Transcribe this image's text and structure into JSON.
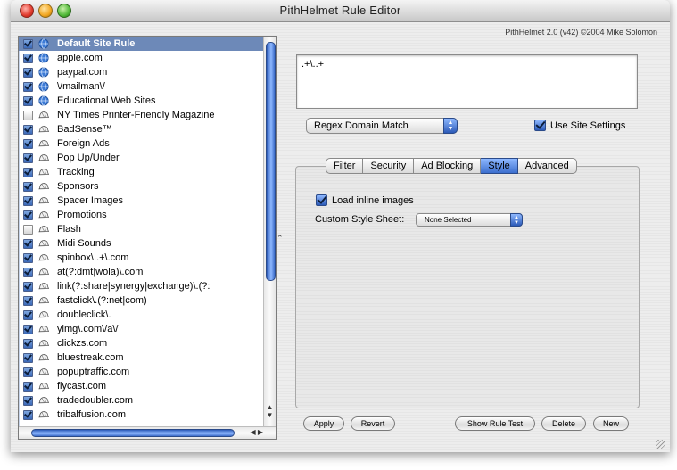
{
  "window": {
    "title": "PithHelmet Rule Editor",
    "copyright": "PithHelmet 2.0 (v42) ©2004 Mike Solomon"
  },
  "rules": [
    {
      "label": "Default Site Rule",
      "checked": true,
      "icon": "globe-icon",
      "selected": true
    },
    {
      "label": "apple.com",
      "checked": true,
      "icon": "globe-icon"
    },
    {
      "label": "paypal.com",
      "checked": true,
      "icon": "globe-icon"
    },
    {
      "label": "\\/mailman\\/",
      "checked": true,
      "icon": "globe-icon"
    },
    {
      "label": "Educational Web Sites",
      "checked": true,
      "icon": "globe-icon"
    },
    {
      "label": "NY Times Printer-Friendly Magazine",
      "checked": false,
      "icon": "pith-helmet-icon"
    },
    {
      "label": "BadSense™",
      "checked": true,
      "icon": "pith-helmet-icon"
    },
    {
      "label": "Foreign Ads",
      "checked": true,
      "icon": "pith-helmet-icon"
    },
    {
      "label": "Pop Up/Under",
      "checked": true,
      "icon": "pith-helmet-icon"
    },
    {
      "label": "Tracking",
      "checked": true,
      "icon": "pith-helmet-icon"
    },
    {
      "label": "Sponsors",
      "checked": true,
      "icon": "pith-helmet-icon"
    },
    {
      "label": "Spacer Images",
      "checked": true,
      "icon": "pith-helmet-icon"
    },
    {
      "label": "Promotions",
      "checked": true,
      "icon": "pith-helmet-icon"
    },
    {
      "label": "Flash",
      "checked": false,
      "icon": "pith-helmet-icon"
    },
    {
      "label": "Midi Sounds",
      "checked": true,
      "icon": "pith-helmet-icon"
    },
    {
      "label": "spinbox\\..+\\.com",
      "checked": true,
      "icon": "pith-helmet-icon"
    },
    {
      "label": "at(?:dmt|wola)\\.com",
      "checked": true,
      "icon": "pith-helmet-icon"
    },
    {
      "label": "link(?:share|synergy|exchange)\\.(?:",
      "checked": true,
      "icon": "pith-helmet-icon"
    },
    {
      "label": "fastclick\\.(?:net|com)",
      "checked": true,
      "icon": "pith-helmet-icon"
    },
    {
      "label": "doubleclick\\.",
      "checked": true,
      "icon": "pith-helmet-icon"
    },
    {
      "label": "yimg\\.com\\/a\\/",
      "checked": true,
      "icon": "pith-helmet-icon"
    },
    {
      "label": "clickzs.com",
      "checked": true,
      "icon": "pith-helmet-icon"
    },
    {
      "label": "bluestreak.com",
      "checked": true,
      "icon": "pith-helmet-icon"
    },
    {
      "label": "popuptraffic.com",
      "checked": true,
      "icon": "pith-helmet-icon"
    },
    {
      "label": "flycast.com",
      "checked": true,
      "icon": "pith-helmet-icon"
    },
    {
      "label": "tradedoubler.com",
      "checked": true,
      "icon": "pith-helmet-icon"
    },
    {
      "label": "tribalfusion.com",
      "checked": true,
      "icon": "pith-helmet-icon"
    }
  ],
  "editor": {
    "pattern": ".+\\..+"
  },
  "match_type": {
    "selected": "Regex Domain Match"
  },
  "use_site_settings": {
    "label": "Use Site Settings",
    "checked": true
  },
  "tabs": [
    {
      "label": "Filter"
    },
    {
      "label": "Security"
    },
    {
      "label": "Ad Blocking"
    },
    {
      "label": "Style",
      "active": true
    },
    {
      "label": "Advanced"
    }
  ],
  "style_tab": {
    "load_inline_images": {
      "label": "Load inline images",
      "checked": true
    },
    "custom_style_sheet": {
      "label": "Custom Style Sheet:",
      "selected": "None Selected"
    }
  },
  "buttons": {
    "apply": "Apply",
    "revert": "Revert",
    "show_rule_test": "Show Rule Test",
    "delete": "Delete",
    "new": "New"
  },
  "colors": {
    "selection": "#6d89b8",
    "aqua_blue": "#3c6fce"
  }
}
